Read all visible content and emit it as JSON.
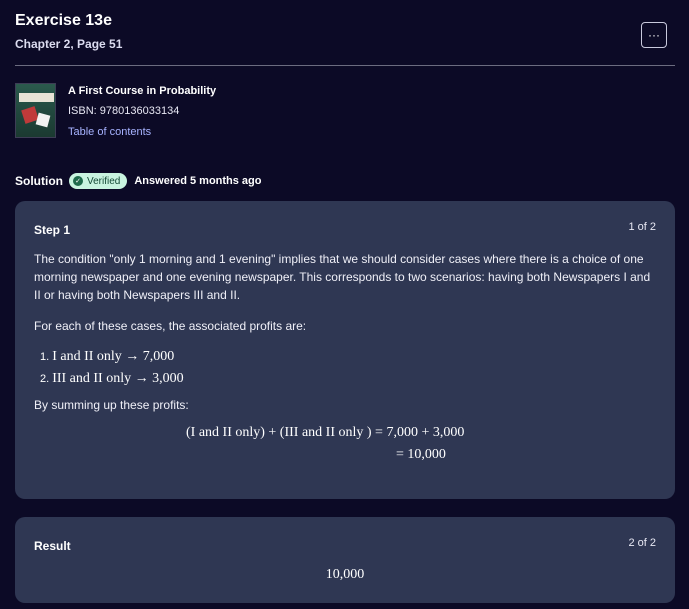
{
  "header": {
    "title": "Exercise 13e",
    "subtitle": "Chapter 2, Page 51",
    "more_label": "···"
  },
  "book": {
    "title": "A First Course in Probability",
    "isbn": "ISBN: 9780136033134",
    "toc_label": "Table of contents"
  },
  "solution": {
    "label": "Solution",
    "verified_label": "Verified",
    "answered": "Answered 5 months ago"
  },
  "step1": {
    "title": "Step 1",
    "count": "1 of 2",
    "para1": "The condition \"only 1 morning and 1 evening\" implies that we should consider cases where there is a choice of one morning newspaper and one evening newspaper. This corresponds to two scenarios: having both Newspapers I and II or having both Newspapers III and II.",
    "para2": "For each of these cases, the associated profits are:",
    "list": [
      {
        "num": "1.",
        "text": "I and II only → 7,000"
      },
      {
        "num": "2.",
        "text": "III and II only  → 3,000"
      }
    ],
    "para3": "By summing up these profits:",
    "equation_line1": "(I and II only) + (III and II only ) = 7,000 + 3,000",
    "equation_line2": "= 10,000"
  },
  "result": {
    "title": "Result",
    "count": "2 of 2",
    "value": "10,000"
  },
  "colors": {
    "background": "#0c0a26",
    "card": "#2f3753",
    "link": "#a7b3ff",
    "verified_bg": "#c9f4e0"
  }
}
